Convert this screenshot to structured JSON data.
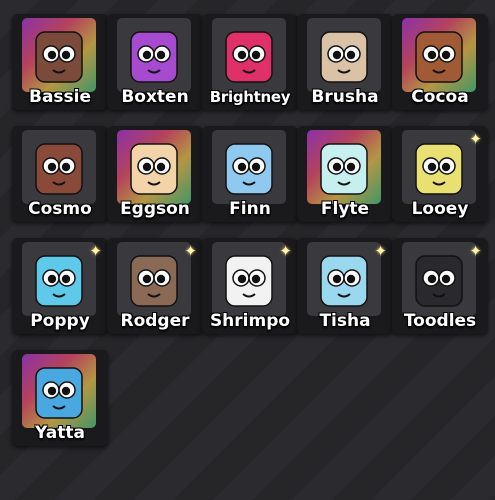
{
  "characters": [
    {
      "name": "Bassie",
      "icon": "bassie-icon",
      "bg": "#3a3a3e",
      "rainbow": true,
      "body": "#7a4a3a",
      "sparkle": false
    },
    {
      "name": "Boxten",
      "icon": "boxten-icon",
      "bg": "#3a3a3e",
      "rainbow": false,
      "body": "#a64ad0",
      "sparkle": false
    },
    {
      "name": "Brightney",
      "icon": "brightney-icon",
      "bg": "#3a3a3e",
      "rainbow": false,
      "body": "#e0306a",
      "sparkle": false
    },
    {
      "name": "Brusha",
      "icon": "brusha-icon",
      "bg": "#3a3a3e",
      "rainbow": false,
      "body": "#d9c2a5",
      "sparkle": false
    },
    {
      "name": "Cocoa",
      "icon": "cocoa-icon",
      "bg": "#3a3a3e",
      "rainbow": true,
      "body": "#a05a35",
      "sparkle": false
    },
    {
      "name": "Cosmo",
      "icon": "cosmo-icon",
      "bg": "#3a3a3e",
      "rainbow": false,
      "body": "#8a4a3a",
      "sparkle": false
    },
    {
      "name": "Eggson",
      "icon": "eggson-icon",
      "bg": "#3a3a3e",
      "rainbow": true,
      "body": "#f2d4a8",
      "sparkle": false
    },
    {
      "name": "Finn",
      "icon": "finn-icon",
      "bg": "#3a3a3e",
      "rainbow": false,
      "body": "#8fc9ef",
      "sparkle": false
    },
    {
      "name": "Flyte",
      "icon": "flyte-icon",
      "bg": "#3a3a3e",
      "rainbow": true,
      "body": "#c6f0ef",
      "sparkle": false
    },
    {
      "name": "Looey",
      "icon": "looey-icon",
      "bg": "#3a3a3e",
      "rainbow": false,
      "body": "#e8e070",
      "sparkle": true
    },
    {
      "name": "Poppy",
      "icon": "poppy-icon",
      "bg": "#3a3a3e",
      "rainbow": false,
      "body": "#5ec9e8",
      "sparkle": true
    },
    {
      "name": "Rodger",
      "icon": "rodger-icon",
      "bg": "#3a3a3e",
      "rainbow": false,
      "body": "#8a6a55",
      "sparkle": true
    },
    {
      "name": "Shrimpo",
      "icon": "shrimpo-icon",
      "bg": "#3a3a3e",
      "rainbow": false,
      "body": "#f2f2f2",
      "sparkle": true
    },
    {
      "name": "Tisha",
      "icon": "tisha-icon",
      "bg": "#3a3a3e",
      "rainbow": false,
      "body": "#9ad8f0",
      "sparkle": true
    },
    {
      "name": "Toodles",
      "icon": "toodles-icon",
      "bg": "#3a3a3e",
      "rainbow": false,
      "body": "#2a2a2e",
      "sparkle": true
    },
    {
      "name": "Yatta",
      "icon": "yatta-icon",
      "bg": "#3a3a3e",
      "rainbow": true,
      "body": "#4aa8e0",
      "sparkle": false
    }
  ]
}
